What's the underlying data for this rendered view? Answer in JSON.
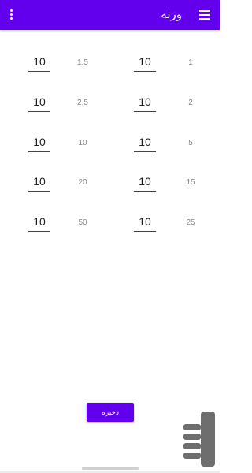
{
  "appbar": {
    "title": "وزنه",
    "menu_icon": "menu-icon",
    "more_icon": "more-vert-icon",
    "accent": "#6200ee"
  },
  "rows": [
    {
      "right": {
        "label": "1",
        "value": "10"
      },
      "left": {
        "label": "1.5",
        "value": "10"
      }
    },
    {
      "right": {
        "label": "2",
        "value": "10"
      },
      "left": {
        "label": "2.5",
        "value": "10"
      }
    },
    {
      "right": {
        "label": "5",
        "value": "10"
      },
      "left": {
        "label": "10",
        "value": "10"
      }
    },
    {
      "right": {
        "label": "15",
        "value": "10"
      },
      "left": {
        "label": "20",
        "value": "10"
      }
    },
    {
      "right": {
        "label": "25",
        "value": "10"
      },
      "left": {
        "label": "50",
        "value": "10"
      }
    }
  ],
  "actions": {
    "save_label": "ذخیره"
  }
}
